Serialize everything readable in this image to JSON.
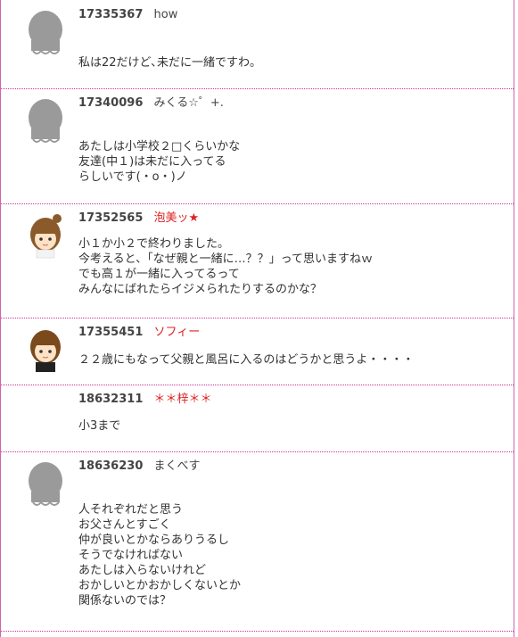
{
  "posts": [
    {
      "number": "17335367",
      "name": "how",
      "name_color": "#444444",
      "avatar": "default-silhouette-icon",
      "body": "私は22だけど､未だに一緒ですわ。"
    },
    {
      "number": "17340096",
      "name": "みくる☆゜+.",
      "name_color": "#444444",
      "avatar": "default-silhouette-icon",
      "body": "あたしは小学校２□くらいかな\n友達(中１)は未だに入ってる\nらしいです(・o・)ノ"
    },
    {
      "number": "17352565",
      "name": "泡美ッ★",
      "name_color": "#dd2222",
      "avatar": "girl-avatar-icon",
      "body": "小１か小２で終わりました。\n今考えると、「なぜ親と一緒に…？？」って思いますねｗ\nでも高１が一緒に入ってるって\nみんなにばれたらイジメられたりするのかな？"
    },
    {
      "number": "17355451",
      "name": "ソフィー",
      "name_color": "#dd2222",
      "avatar": "girl-bob-avatar-icon",
      "body": "２２歳にもなって父親と風呂に入るのはどうかと思うよ・・・・"
    },
    {
      "number": "18632311",
      "name": "＊＊梓＊＊",
      "name_color": "#dd2222",
      "avatar": "",
      "body": "小3まで"
    },
    {
      "number": "18636230",
      "name": "まくべす",
      "name_color": "#444444",
      "avatar": "default-silhouette-icon",
      "body": "人それぞれだと思う\nお父さんとすごく\n仲が良いとかならありうるし\nそうでなければない\nあたしは入らないけれど\nおかしいとかおかしくないとか\n関係ないのでは？"
    }
  ]
}
